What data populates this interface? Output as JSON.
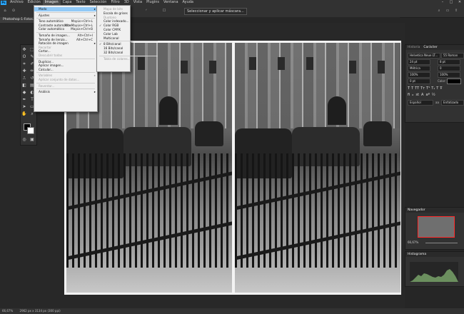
{
  "menubar": {
    "items": [
      "Archivo",
      "Edición",
      "Imagen",
      "Capa",
      "Texto",
      "Selección",
      "Filtro",
      "3D",
      "Vista",
      "Plugins",
      "Ventana",
      "Ayuda"
    ],
    "active_index": 2
  },
  "options_bar": {
    "select_mask_label": "Seleccionar y aplicar máscara..."
  },
  "document": {
    "tab_title": "Photoshop-1-Fotos.jpg @ 66,7% (RGB/8)"
  },
  "status": {
    "zoom": "66,67%",
    "doc_info": "2962 px x 3134 px (300 ppi)"
  },
  "image_menu": {
    "items": [
      {
        "label": "Modo",
        "shortcut": "",
        "submenu": true,
        "disabled": false,
        "highlight": true
      },
      {
        "sep": true
      },
      {
        "label": "Ajustes",
        "shortcut": "",
        "submenu": true,
        "disabled": false
      },
      {
        "sep": true
      },
      {
        "label": "Tono automático",
        "shortcut": "Mayús+Ctrl+L",
        "disabled": false
      },
      {
        "label": "Contraste automático",
        "shortcut": "Alt+Mayús+Ctrl+L",
        "disabled": false
      },
      {
        "label": "Color automático",
        "shortcut": "Mayús+Ctrl+B",
        "disabled": false
      },
      {
        "sep": true
      },
      {
        "label": "Tamaño de imagen...",
        "shortcut": "Alt+Ctrl+I",
        "disabled": false
      },
      {
        "label": "Tamaño de lienzo...",
        "shortcut": "Alt+Ctrl+C",
        "disabled": false
      },
      {
        "label": "Rotación de imagen",
        "shortcut": "",
        "submenu": true,
        "disabled": false
      },
      {
        "label": "Recortar",
        "shortcut": "",
        "disabled": true
      },
      {
        "label": "Cortar...",
        "shortcut": "",
        "disabled": false
      },
      {
        "label": "Descubrir todas",
        "shortcut": "",
        "disabled": true
      },
      {
        "sep": true
      },
      {
        "label": "Duplicar...",
        "shortcut": "",
        "disabled": false
      },
      {
        "label": "Aplicar imagen...",
        "shortcut": "",
        "disabled": false
      },
      {
        "label": "Calcular...",
        "shortcut": "",
        "disabled": false
      },
      {
        "sep": true
      },
      {
        "label": "Variables",
        "shortcut": "",
        "submenu": true,
        "disabled": true
      },
      {
        "label": "Aplicar conjunto de datos...",
        "shortcut": "",
        "disabled": true
      },
      {
        "sep": true
      },
      {
        "label": "Reventar...",
        "shortcut": "",
        "disabled": true
      },
      {
        "sep": true
      },
      {
        "label": "Análisis",
        "shortcut": "",
        "submenu": true,
        "disabled": false
      }
    ]
  },
  "mode_submenu": {
    "items": [
      {
        "label": "Mapa de bits",
        "disabled": true
      },
      {
        "label": "Escala de grises",
        "disabled": false
      },
      {
        "label": "Duotono",
        "disabled": true
      },
      {
        "label": "Color indexado...",
        "disabled": false
      },
      {
        "label": "Color RGB",
        "disabled": false,
        "checked": true
      },
      {
        "label": "Color CMYK",
        "disabled": false
      },
      {
        "label": "Color Lab",
        "disabled": false
      },
      {
        "label": "Multicanal",
        "disabled": false
      },
      {
        "sep": true
      },
      {
        "label": "8 Bits/canal",
        "disabled": false,
        "checked": true
      },
      {
        "label": "16 Bits/canal",
        "disabled": false
      },
      {
        "label": "32 Bits/canal",
        "disabled": false
      },
      {
        "sep": true
      },
      {
        "label": "Tabla de colores...",
        "disabled": true
      }
    ]
  },
  "character_panel": {
    "tabs": [
      "Historia",
      "Carácter"
    ],
    "font_family": "Helvetica Neue LT...",
    "font_style": "55 Roman",
    "size": "24 pt",
    "leading": "8 pt",
    "kerning": "Métrica",
    "tracking": "0",
    "scale_v": "100%",
    "scale_h": "100%",
    "baseline": "0 pt",
    "color_label": "Color:",
    "language": "Español",
    "antialias": "Enfatizado",
    "antialias_short": "aa"
  },
  "navigator_panel": {
    "title": "Navegador",
    "zoom": "66,67%"
  },
  "histogram_panel": {
    "title": "Histograma"
  },
  "colors": {
    "menu_bg": "#f0f0f0",
    "highlight": "#91c9f7",
    "ui_dark": "#323232",
    "ps_blue": "#2aa9ff"
  }
}
